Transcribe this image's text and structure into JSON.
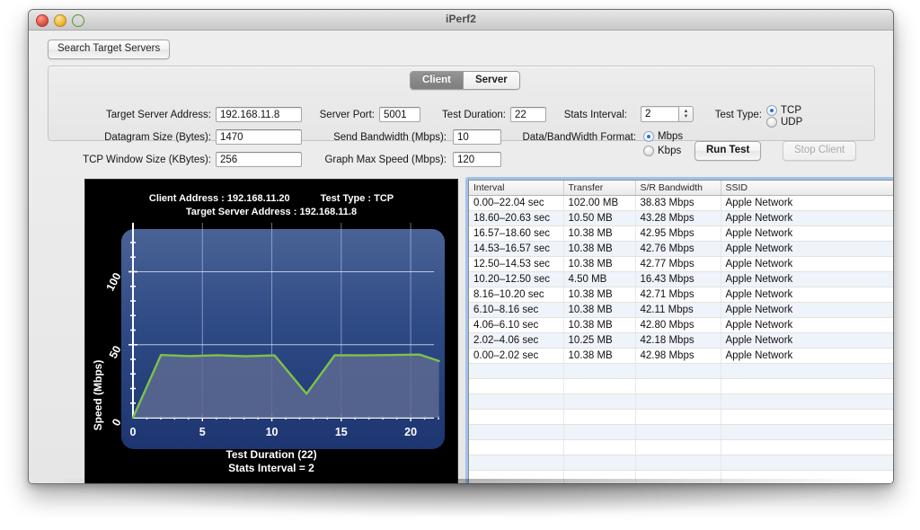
{
  "window": {
    "title": "iPerf2",
    "traffic_lights": [
      "close-red",
      "minimize-yellow",
      "zoom-green"
    ]
  },
  "toolbar": {
    "search_servers_label": "Search Target Servers"
  },
  "tabs": {
    "client_label": "Client",
    "server_label": "Server",
    "active": "Client"
  },
  "form": {
    "target_server_address_label": "Target Server Address:",
    "target_server_address_value": "192.168.11.8",
    "datagram_size_label": "Datagram Size (Bytes):",
    "datagram_size_value": "1470",
    "tcp_window_size_label": "TCP Window Size (KBytes):",
    "tcp_window_size_value": "256",
    "server_port_label": "Server Port:",
    "server_port_value": "5001",
    "send_bandwidth_label": "Send Bandwidth (Mbps):",
    "send_bandwidth_value": "10",
    "graph_max_speed_label": "Graph Max Speed (Mbps):",
    "graph_max_speed_value": "120",
    "test_duration_label": "Test Duration:",
    "test_duration_value": "22",
    "stats_interval_label": "Stats Interval:",
    "stats_interval_value": "2",
    "data_format_label": "Data/BandWidth Format:",
    "data_format_mbps": "Mbps",
    "data_format_kbps": "Kbps",
    "data_format_selected": "Mbps",
    "test_type_label": "Test Type:",
    "test_type_tcp": "TCP",
    "test_type_udp": "UDP",
    "test_type_selected": "TCP",
    "run_test_label": "Run Test",
    "stop_client_label": "Stop Client"
  },
  "graph": {
    "client_address_label": "Client Address : 192.168.11.20",
    "target_server_address_label": "Target Server Address : 192.168.11.8",
    "test_type_label": "Test Type : TCP",
    "xlabel_line1": "Test Duration (22)",
    "xlabel_line2": "Stats Interval = 2",
    "ylabel": "Speed (Mbps)",
    "line_color": "#7dc24b",
    "plot_bg": "#2e4a85",
    "fill_color": "#5d6a90"
  },
  "chart_data": {
    "type": "area",
    "title": "",
    "xlabel": "Test Duration (22)",
    "ylabel": "Speed (Mbps)",
    "xlim": [
      0,
      22
    ],
    "ylim": [
      0,
      120
    ],
    "xticks": [
      0,
      5,
      10,
      15,
      20
    ],
    "yticks": [
      0,
      50,
      100
    ],
    "ytick_labels": [
      "0",
      "50",
      "100"
    ],
    "xtick_labels": [
      "0",
      "5",
      "10",
      "15",
      "20"
    ],
    "grid": true,
    "legend": "none",
    "x": [
      0,
      2.02,
      4.06,
      6.1,
      8.16,
      10.2,
      12.5,
      14.53,
      16.57,
      18.6,
      20.63,
      22.04
    ],
    "series": [
      {
        "name": "S/R Bandwidth (Mbps)",
        "values": [
          0,
          42.98,
          42.18,
          42.8,
          42.11,
          42.71,
          16.43,
          42.77,
          42.76,
          42.95,
          43.28,
          38.83
        ]
      }
    ]
  },
  "table": {
    "columns": [
      "Interval",
      "Transfer",
      "S/R Bandwidth",
      "SSID"
    ],
    "rows": [
      [
        "0.00–22.04 sec",
        "102.00 MB",
        "38.83 Mbps",
        "Apple Network"
      ],
      [
        "18.60–20.63 sec",
        "10.50 MB",
        "43.28 Mbps",
        "Apple Network"
      ],
      [
        "16.57–18.60 sec",
        "10.38 MB",
        "42.95 Mbps",
        "Apple Network"
      ],
      [
        "14.53–16.57 sec",
        "10.38 MB",
        "42.76 Mbps",
        "Apple Network"
      ],
      [
        "12.50–14.53 sec",
        "10.38 MB",
        "42.77 Mbps",
        "Apple Network"
      ],
      [
        "10.20–12.50 sec",
        "4.50 MB",
        "16.43 Mbps",
        "Apple Network"
      ],
      [
        "8.16–10.20 sec",
        "10.38 MB",
        "42.71 Mbps",
        "Apple Network"
      ],
      [
        "6.10–8.16 sec",
        "10.38 MB",
        "42.11 Mbps",
        "Apple Network"
      ],
      [
        "4.06–6.10 sec",
        "10.38 MB",
        "42.80 Mbps",
        "Apple Network"
      ],
      [
        "2.02–4.06 sec",
        "10.25 MB",
        "42.18 Mbps",
        "Apple Network"
      ],
      [
        "0.00–2.02 sec",
        "10.38 MB",
        "42.98 Mbps",
        "Apple Network"
      ]
    ],
    "empty_row_count": 10
  }
}
